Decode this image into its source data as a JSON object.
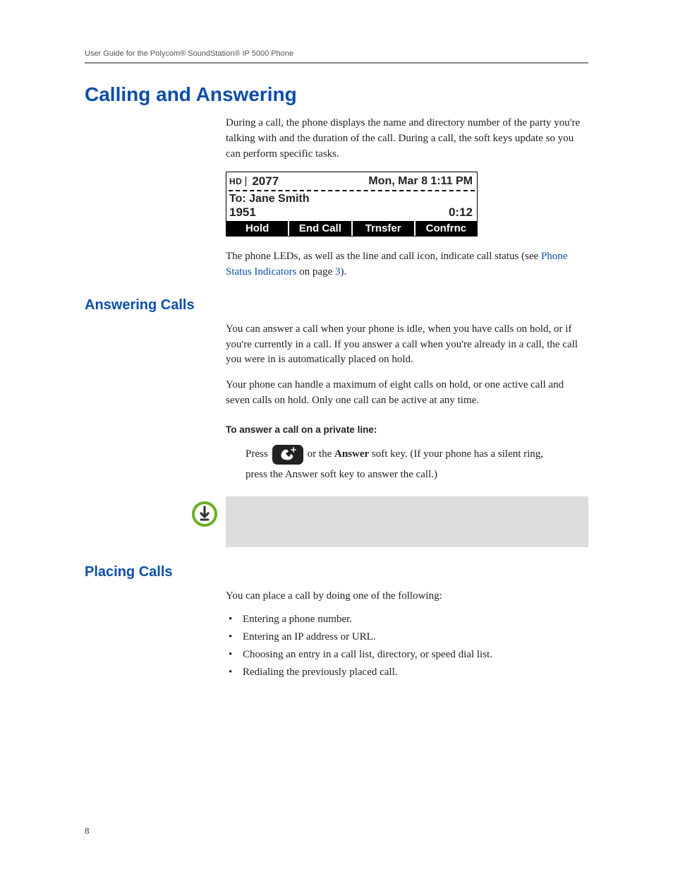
{
  "running_head": "User Guide for the Polycom® SoundStation® IP 5000 Phone",
  "page_number": "8",
  "h1": "Calling and Answering",
  "intro_para": "During a call, the phone displays the name and directory number of the party you're talking with and the duration of the call. During a call, the soft keys update so you can perform specific tasks.",
  "phone": {
    "hd": "HD",
    "ext": "2077",
    "datetime": "Mon, Mar 8   1:11 PM",
    "to_label": "To:",
    "to_name": "Jane Smith",
    "from_number": "1951",
    "elapsed": "0:12",
    "softkeys": [
      "Hold",
      "End Call",
      "Trnsfer",
      "Confrnc"
    ]
  },
  "led_para_pre": "The phone LEDs, as well as the line and call icon, indicate call status (see ",
  "led_link1": "Phone Status Indicators",
  "led_para_mid": " on page ",
  "led_link2": "3",
  "led_para_post": ").",
  "h2_answering": "Answering Calls",
  "answering_p1": "You can answer a call when your phone is idle, when you have calls on hold, or if you're currently in a call. If you answer a call when you're already in a call, the call you were in is automatically placed on hold.",
  "answering_p2": "Your phone can handle a maximum of eight calls on hold, or one active call and seven calls on hold. Only one call can be active at any time.",
  "procedure_head": "To answer a call on a private line:",
  "press_label": "Press",
  "press_mid": " or the ",
  "answer_bold": "Answer",
  "press_tail": " soft key. (If your phone has a silent ring, press the Answer soft key to answer the call.)",
  "h2_placing": "Placing Calls",
  "placing_intro": "You can place a call by doing one of the following:",
  "placing_bullets": [
    "Entering a phone number.",
    "Entering an IP address or URL.",
    "Choosing an entry in a call list, directory, or speed dial list.",
    "Redialing the previously placed call."
  ]
}
